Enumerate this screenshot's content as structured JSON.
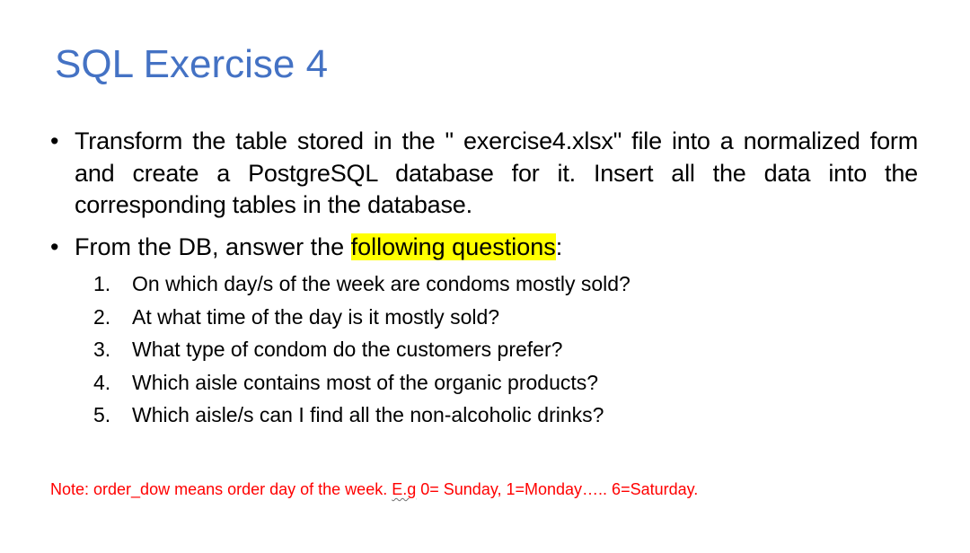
{
  "slide": {
    "title": "SQL Exercise 4",
    "bullets": [
      {
        "marker": "•",
        "text": "Transform the table stored in the \" exercise4.xlsx\" file into a normalized form and create a PostgreSQL database for it. Insert all the data into the corresponding tables in the database."
      },
      {
        "marker": "•",
        "text_before": "From the DB, answer the ",
        "highlight": "following questions",
        "text_after": ":"
      }
    ],
    "questions": [
      {
        "number": "1.",
        "text": "On which day/s of the week are condoms mostly sold?"
      },
      {
        "number": "2.",
        "text": "At what time of the day is it mostly sold?"
      },
      {
        "number": "3.",
        "text": "What type of condom do the customers prefer?"
      },
      {
        "number": "4.",
        "text": "Which aisle contains most of the organic products?"
      },
      {
        "number": "5.",
        "text": "Which aisle/s can I find all the non-alcoholic drinks?"
      }
    ],
    "note": {
      "before": "Note: order_dow means order day of the week. ",
      "squiggle": "E.g",
      "after": " 0= Sunday, 1=Monday….. 6=Saturday."
    }
  },
  "colors": {
    "title": "#4472c4",
    "highlight": "#ffff00",
    "note": "#ff0000",
    "text": "#000000"
  }
}
